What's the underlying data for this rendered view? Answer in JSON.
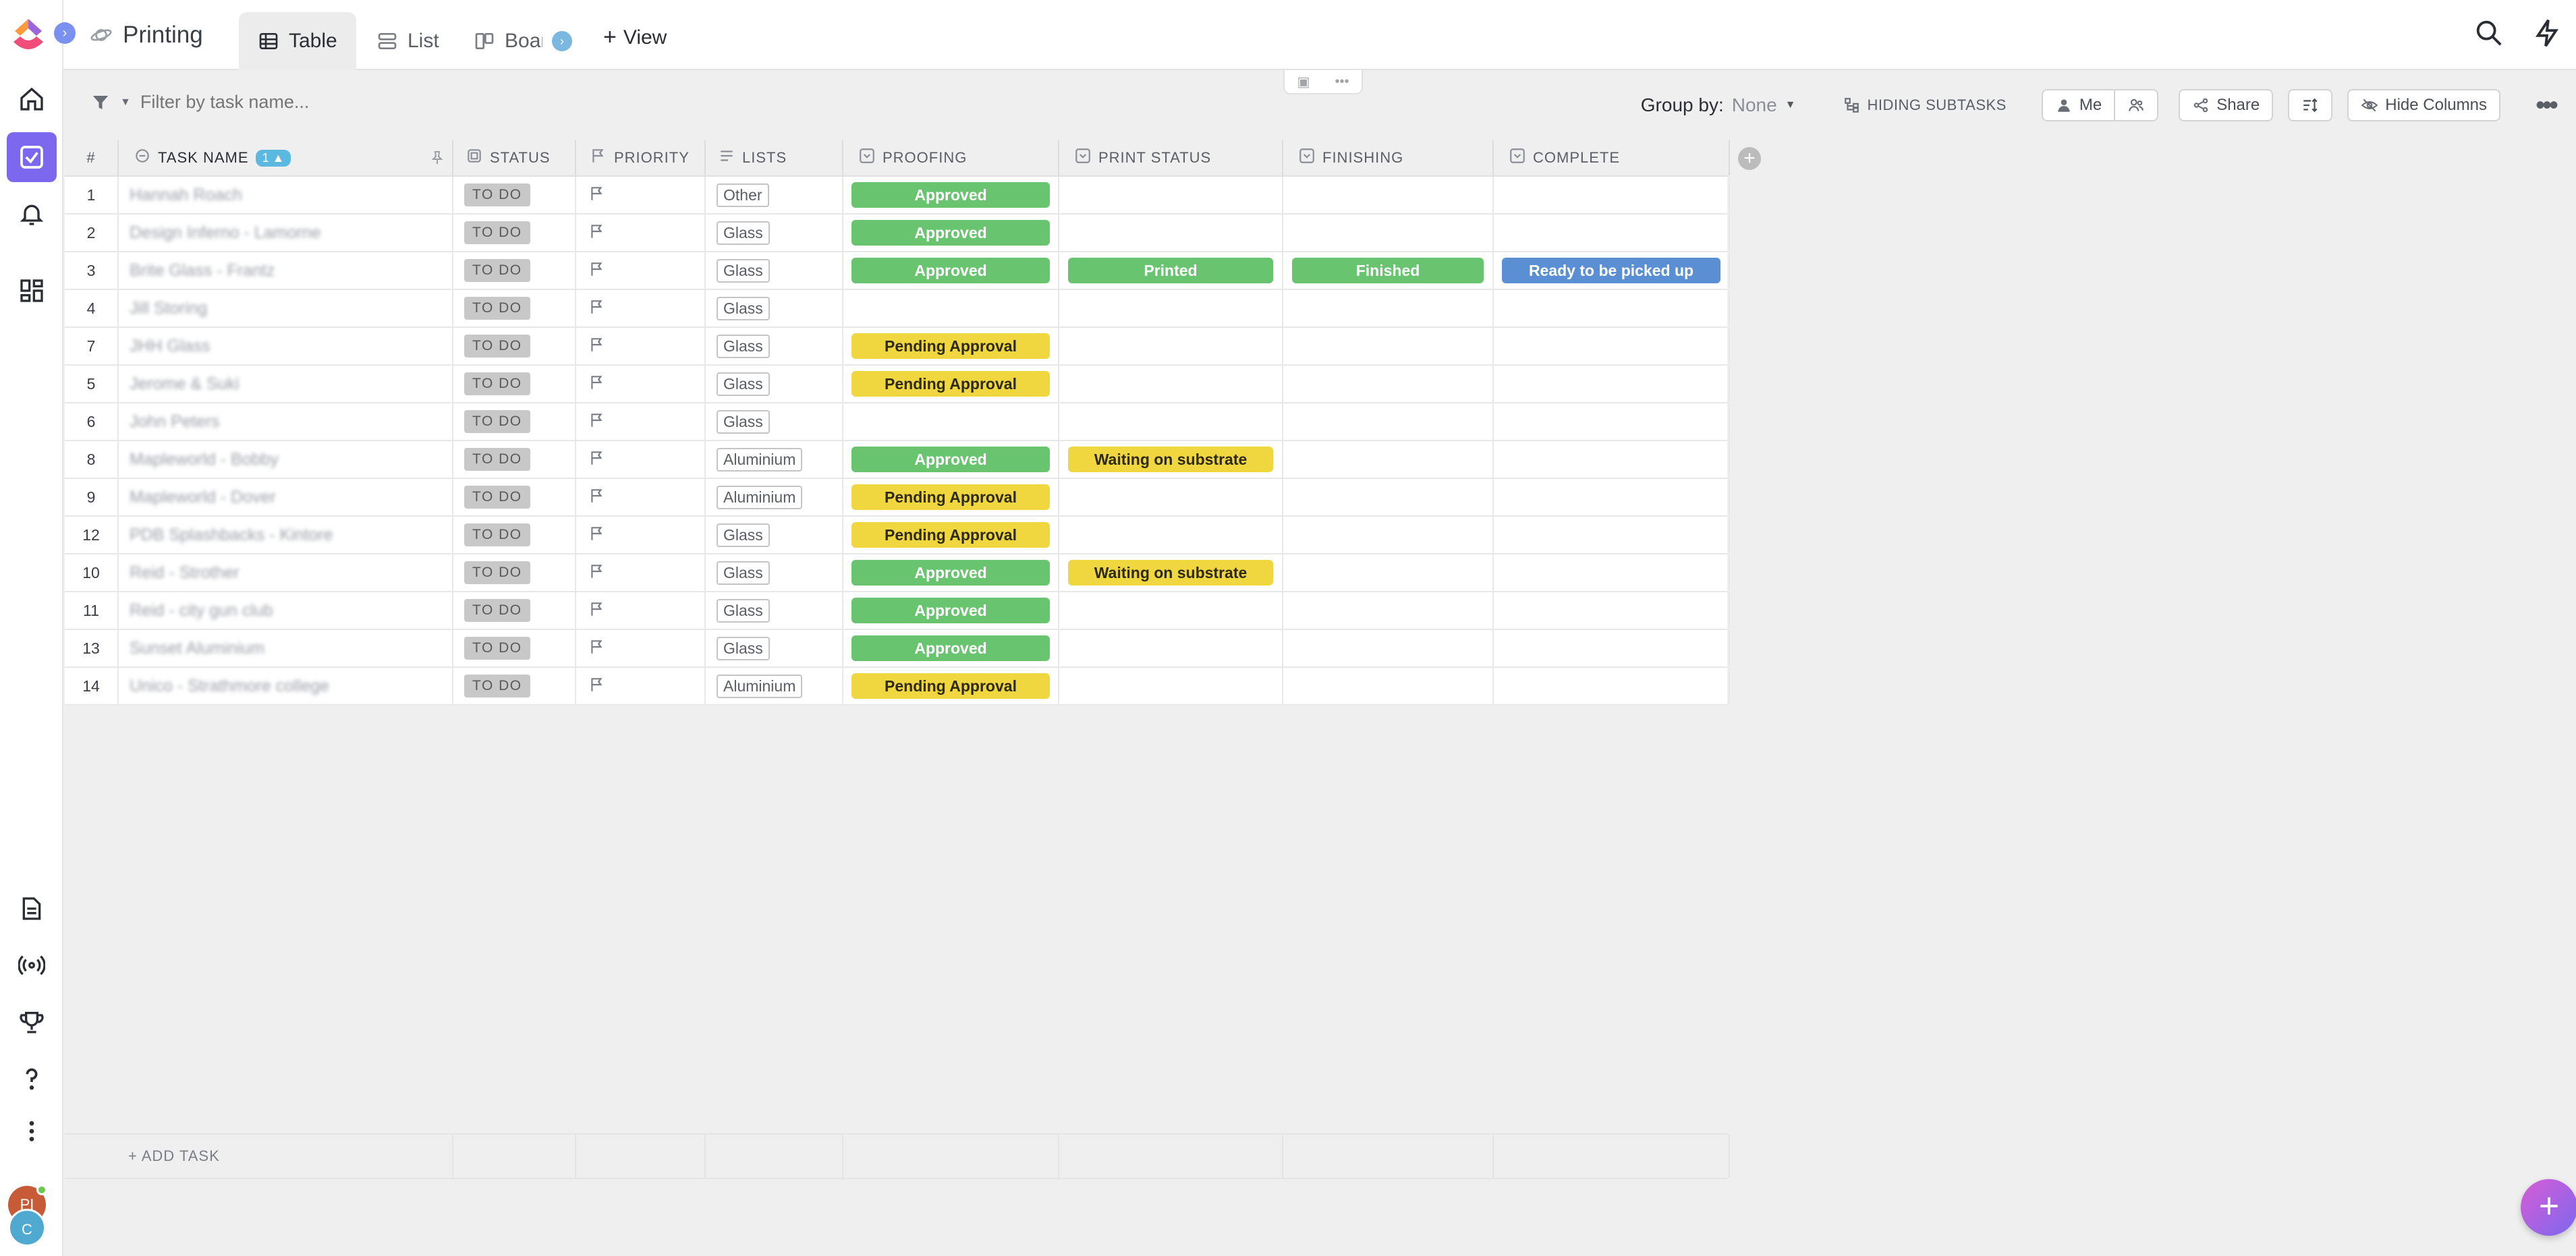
{
  "app": {
    "space_title": "Printing",
    "tabs": [
      {
        "label": "Table",
        "active": true
      },
      {
        "label": "List",
        "active": false
      },
      {
        "label": "Board",
        "active": false
      }
    ],
    "add_view_label": "View",
    "colors": {
      "accent": "#7b68ee",
      "approved": "#68c46f",
      "pending": "#f0d740",
      "ready": "#5b8fd3"
    }
  },
  "sidebar": {
    "items": [
      {
        "icon": "home-icon"
      },
      {
        "icon": "tasks-icon",
        "active": true
      },
      {
        "icon": "bell-icon"
      },
      {
        "icon": "dashboard-icon"
      }
    ],
    "bottom_items": [
      {
        "icon": "docs-icon"
      },
      {
        "icon": "pulse-icon"
      },
      {
        "icon": "trophy-icon"
      },
      {
        "icon": "help-icon"
      },
      {
        "icon": "more-vertical-icon"
      }
    ],
    "avatars": [
      "PI",
      "C"
    ]
  },
  "toolbar": {
    "filter_placeholder": "Filter by task name...",
    "group_by_label": "Group by:",
    "group_by_value": "None",
    "hiding_subtasks": "HIDING SUBTASKS",
    "me_label": "Me",
    "share_label": "Share",
    "hide_columns_label": "Hide Columns"
  },
  "table": {
    "columns": {
      "num": "#",
      "name": "TASK NAME",
      "sort_badge": "1",
      "status": "STATUS",
      "priority": "PRIORITY",
      "lists": "LISTS",
      "proofing": "PROOFING",
      "print_status": "PRINT STATUS",
      "finishing": "FINISHING",
      "complete": "COMPLETE"
    },
    "rows": [
      {
        "num": "1",
        "name": "Hannah Roach",
        "status": "TO DO",
        "list": "Other",
        "proofing": "Approved",
        "print": "",
        "finishing": "",
        "complete": ""
      },
      {
        "num": "2",
        "name": "Design Inferno - Lamorne",
        "status": "TO DO",
        "list": "Glass",
        "proofing": "Approved",
        "print": "",
        "finishing": "",
        "complete": ""
      },
      {
        "num": "3",
        "name": "Brite Glass - Frantz",
        "status": "TO DO",
        "list": "Glass",
        "proofing": "Approved",
        "print": "Printed",
        "finishing": "Finished",
        "complete": "Ready to be picked up"
      },
      {
        "num": "4",
        "name": "Jill Storing",
        "status": "TO DO",
        "list": "Glass",
        "proofing": "",
        "print": "",
        "finishing": "",
        "complete": ""
      },
      {
        "num": "7",
        "name": "JHH Glass",
        "status": "TO DO",
        "list": "Glass",
        "proofing": "Pending Approval",
        "print": "",
        "finishing": "",
        "complete": ""
      },
      {
        "num": "5",
        "name": "Jerome & Suki",
        "status": "TO DO",
        "list": "Glass",
        "proofing": "Pending Approval",
        "print": "",
        "finishing": "",
        "complete": ""
      },
      {
        "num": "6",
        "name": "John Peters",
        "status": "TO DO",
        "list": "Glass",
        "proofing": "",
        "print": "",
        "finishing": "",
        "complete": ""
      },
      {
        "num": "8",
        "name": "Mapleworld - Bobby",
        "status": "TO DO",
        "list": "Aluminium",
        "proofing": "Approved",
        "print": "Waiting on substrate",
        "finishing": "",
        "complete": ""
      },
      {
        "num": "9",
        "name": "Mapleworld - Dover",
        "status": "TO DO",
        "list": "Aluminium",
        "proofing": "Pending Approval",
        "print": "",
        "finishing": "",
        "complete": ""
      },
      {
        "num": "12",
        "name": "PDB Splashbacks - Kintore",
        "status": "TO DO",
        "list": "Glass",
        "proofing": "Pending Approval",
        "print": "",
        "finishing": "",
        "complete": ""
      },
      {
        "num": "10",
        "name": "Reid - Strother",
        "status": "TO DO",
        "list": "Glass",
        "proofing": "Approved",
        "print": "Waiting on substrate",
        "finishing": "",
        "complete": ""
      },
      {
        "num": "11",
        "name": "Reid - city gun club",
        "status": "TO DO",
        "list": "Glass",
        "proofing": "Approved",
        "print": "",
        "finishing": "",
        "complete": ""
      },
      {
        "num": "13",
        "name": "Sunset Aluminium",
        "status": "TO DO",
        "list": "Glass",
        "proofing": "Approved",
        "print": "",
        "finishing": "",
        "complete": ""
      },
      {
        "num": "14",
        "name": "Unico - Strathmore college",
        "status": "TO DO",
        "list": "Aluminium",
        "proofing": "Pending Approval",
        "print": "",
        "finishing": "",
        "complete": ""
      }
    ],
    "add_task_label": "+ ADD TASK"
  }
}
